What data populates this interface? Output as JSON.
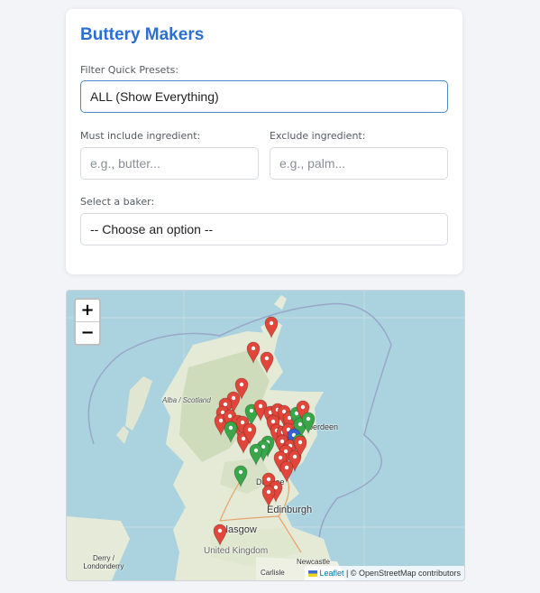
{
  "app": {
    "title": "Buttery Makers"
  },
  "filters": {
    "preset_label": "Filter Quick Presets:",
    "preset_value": "ALL (Show Everything)",
    "include_label": "Must include ingredient:",
    "include_placeholder": "e.g., butter...",
    "exclude_label": "Exclude ingredient:",
    "exclude_placeholder": "e.g., palm...",
    "baker_label": "Select a baker:",
    "baker_value": "-- Choose an option --"
  },
  "map": {
    "zoom_in": "+",
    "zoom_out": "−",
    "place_labels": [
      "Alba / Scotland",
      "Aberdeen",
      "Dundee",
      "Edinburgh",
      "Glasgow",
      "United Kingdom",
      "Derry / Londonderry",
      "Newcastle",
      "Carlisle"
    ],
    "attribution": {
      "leaflet": "Leaflet",
      "rest": " | © OpenStreetMap contributors"
    },
    "marker_colors": {
      "red": "#e0463a",
      "green": "#3aa64a",
      "blue": "#3b5fcf"
    }
  }
}
